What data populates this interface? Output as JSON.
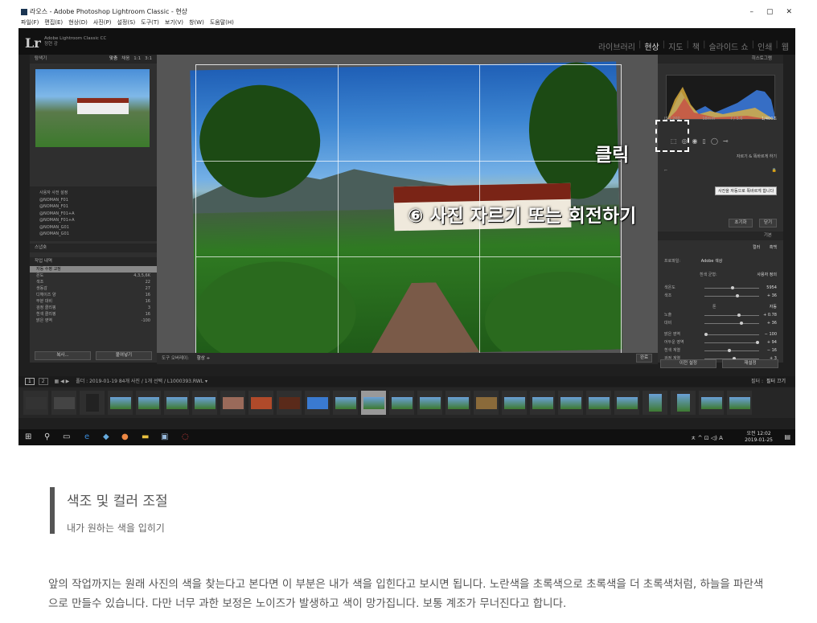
{
  "window": {
    "title": "라오스 - Adobe Photoshop Lightroom Classic - 현상",
    "min": "–",
    "max": "▢",
    "close": "✕"
  },
  "menubar": [
    "파일(F)",
    "편집(E)",
    "현상(D)",
    "사진(P)",
    "설정(S)",
    "도구(T)",
    "보기(V)",
    "창(W)",
    "도움말(H)"
  ],
  "lr": {
    "logo": "Lr",
    "product": "Adobe Lightroom Classic CC",
    "user": "정현 강",
    "modules": [
      "라이브러리",
      "현상",
      "지도",
      "책",
      "슬라이드 쇼",
      "인쇄",
      "웹"
    ],
    "active_module": "현상"
  },
  "left": {
    "navigator": "탐색기",
    "nav_opts": [
      "맞춤",
      "채움",
      "1:1",
      "3:1"
    ],
    "presets": [
      "사용자 사전 설정",
      "@NOMAN_F01",
      "@NOMAN_F01",
      "@NOMAN_F01+A",
      "@NOMAN_F01+A",
      "@NOMAN_G01",
      "@NOMAN_G01"
    ],
    "snapshots": "스냅숏",
    "history": "작업 내역",
    "history_items": [
      "자동 수평 교정",
      "온도",
      "색조",
      "생동감",
      "디헤이즈 양",
      "부분 대비",
      "검정 클리핑",
      "흰색 클리핑",
      "밝은 영역"
    ],
    "history_vals": [
      "",
      "4,3,5,6K",
      "22",
      "27",
      "16",
      "16",
      "3",
      "16",
      "-100"
    ],
    "copy_btn": "복사...",
    "paste_btn": "붙여넣기"
  },
  "right": {
    "histogram": "히스토그램",
    "iso": "ISO 200",
    "focal": "18mm",
    "aperture": "f / 5.6",
    "shutter": "1/400초",
    "transform_link": "자르기 & 똑바르게 하기",
    "tooltip": "사진을 자동으로 똑바르게 합니다",
    "reset": "초기화",
    "close": "닫기",
    "basic": "기본",
    "treatment_color": "컬러",
    "treatment_bw": "흑백",
    "profile_label": "프로파일:",
    "profile": "Adobe 색상",
    "wb_label": "흰색 균형:",
    "wb_value": "사용자 정의",
    "temp_label": "색온도",
    "temp": "5954",
    "tint_label": "색조",
    "tint": "+ 36",
    "tone": "톤",
    "tone_auto": "자동",
    "exposure_label": "노출",
    "exposure": "+ 0.78",
    "contrast_label": "대비",
    "contrast": "+ 36",
    "highlights_label": "밝은 영역",
    "highlights": "− 100",
    "shadows_label": "어두운 영역",
    "shadows": "+ 94",
    "whites_label": "흰색 계열",
    "whites": "− 16",
    "blacks_label": "검정 계열",
    "blacks": "+ 3",
    "prev_btn": "이전 설정",
    "reset_btn": "재설정"
  },
  "toolbar": {
    "overlay_label": "도구 오버레이:",
    "overlay_val": "항상 ÷",
    "done": "완료"
  },
  "filmstrip": {
    "info": "폴더 : 2019-01-19   84개 사진 / 1개 선택 / L1000393.RWL ▾",
    "filter": "필터 :",
    "filter_val": "필터 끄기"
  },
  "taskbar": {
    "time": "오전 12:02",
    "date": "2019-01-25"
  },
  "annotations": {
    "click": "클릭",
    "step": "⑥ 사진 자르기 또는 회전하기"
  },
  "article": {
    "heading": "색조 및 컬러 조절",
    "subheading": "내가 원하는 색을 입히기",
    "paragraph": "앞의 작업까지는 원래 사진의 색을 찾는다고 본다면 이 부분은 내가 색을 입힌다고 보시면 됩니다. 노란색을 초록색으로 초록색을 더 초록색처럼, 하늘을 파란색으로 만들수 있습니다. 다만 너무 과한 보정은 노이즈가 발생하고 색이 망가집니다.  보통 계조가 무너진다고 합니다."
  }
}
